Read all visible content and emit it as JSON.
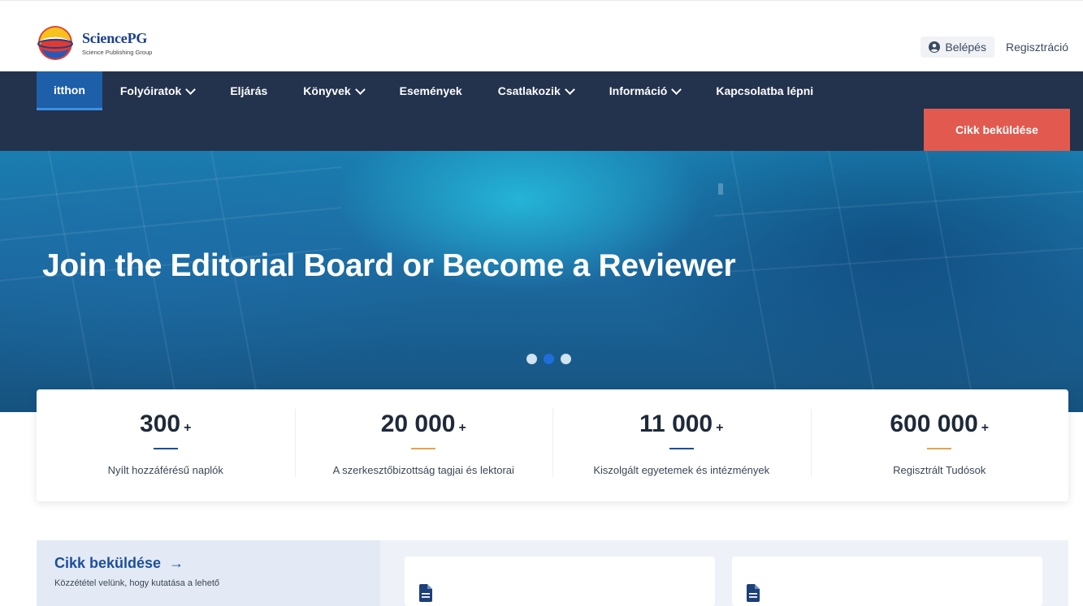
{
  "brand": {
    "name": "SciencePG",
    "subtitle": "Science Publishing Group"
  },
  "auth": {
    "login_label": "Belépés",
    "register_label": "Regisztráció"
  },
  "nav": {
    "items": [
      {
        "label": "itthon",
        "active": true,
        "dropdown": false
      },
      {
        "label": "Folyóiratok",
        "active": false,
        "dropdown": true
      },
      {
        "label": "Eljárás",
        "active": false,
        "dropdown": false
      },
      {
        "label": "Könyvek",
        "active": false,
        "dropdown": true
      },
      {
        "label": "Események",
        "active": false,
        "dropdown": false
      },
      {
        "label": "Csatlakozik",
        "active": false,
        "dropdown": true
      },
      {
        "label": "Információ",
        "active": false,
        "dropdown": true
      },
      {
        "label": "Kapcsolatba lépni",
        "active": false,
        "dropdown": false
      }
    ],
    "submit_label": "Cikk beküldése"
  },
  "hero": {
    "title": "Join the Editorial Board or Become a Reviewer",
    "slide_count": 3,
    "active_slide": 2
  },
  "stats": [
    {
      "value": "300",
      "suffix": "+",
      "label": "Nyílt hozzáférésű naplók",
      "accent": "#1d4f9a"
    },
    {
      "value": "20 000",
      "suffix": "+",
      "label": "A szerkesztőbizottság tagjai és lektorai",
      "accent": "#e8a24a"
    },
    {
      "value": "11 000",
      "suffix": "+",
      "label": "Kiszolgált egyetemek és intézmények",
      "accent": "#1d4f9a"
    },
    {
      "value": "600 000",
      "suffix": "+",
      "label": "Regisztrált Tudósok",
      "accent": "#e8a24a"
    }
  ],
  "promo": {
    "title": "Cikk beküldése",
    "text": "Közzététel velünk, hogy kutatása a lehető"
  },
  "colors": {
    "nav_bg": "#23324d",
    "nav_active": "#1d5fa8",
    "submit_bg": "#e25a4f",
    "brand_blue": "#1a3f8f"
  },
  "icons": {
    "login": "user-circle-icon",
    "dropdown": "chevron-down-icon",
    "promo_arrow": "arrow-right-icon",
    "card": "document-icon"
  }
}
